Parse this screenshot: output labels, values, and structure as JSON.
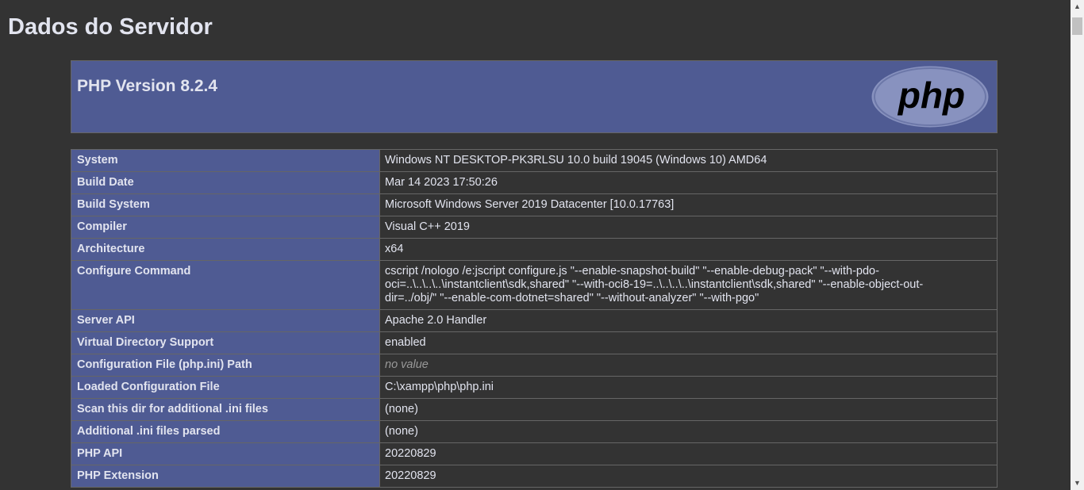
{
  "page": {
    "title": "Dados do Servidor"
  },
  "header": {
    "version": "PHP Version 8.2.4",
    "logo_text": "php"
  },
  "info_rows": [
    {
      "label": "System",
      "value": "Windows NT DESKTOP-PK3RLSU 10.0 build 19045 (Windows 10) AMD64"
    },
    {
      "label": "Build Date",
      "value": "Mar 14 2023 17:50:26"
    },
    {
      "label": "Build System",
      "value": "Microsoft Windows Server 2019 Datacenter [10.0.17763]"
    },
    {
      "label": "Compiler",
      "value": "Visual C++ 2019"
    },
    {
      "label": "Architecture",
      "value": "x64"
    },
    {
      "label": "Configure Command",
      "value": "cscript /nologo /e:jscript configure.js \"--enable-snapshot-build\" \"--enable-debug-pack\" \"--with-pdo-oci=..\\..\\..\\..\\instantclient\\sdk,shared\" \"--with-oci8-19=..\\..\\..\\..\\instantclient\\sdk,shared\" \"--enable-object-out-dir=../obj/\" \"--enable-com-dotnet=shared\" \"--without-analyzer\" \"--with-pgo\""
    },
    {
      "label": "Server API",
      "value": "Apache 2.0 Handler"
    },
    {
      "label": "Virtual Directory Support",
      "value": "enabled"
    },
    {
      "label": "Configuration File (php.ini) Path",
      "value": "no value"
    },
    {
      "label": "Loaded Configuration File",
      "value": "C:\\xampp\\php\\php.ini"
    },
    {
      "label": "Scan this dir for additional .ini files",
      "value": "(none)"
    },
    {
      "label": "Additional .ini files parsed",
      "value": "(none)"
    },
    {
      "label": "PHP API",
      "value": "20220829"
    },
    {
      "label": "PHP Extension",
      "value": "20220829"
    }
  ],
  "colors": {
    "background": "#333333",
    "header_bg": "#4f5b93",
    "text": "#e2e4ef",
    "muted": "#999999"
  },
  "icons": {
    "scroll_up": "scroll-up-arrow-icon",
    "scroll_down": "scroll-down-arrow-icon"
  }
}
